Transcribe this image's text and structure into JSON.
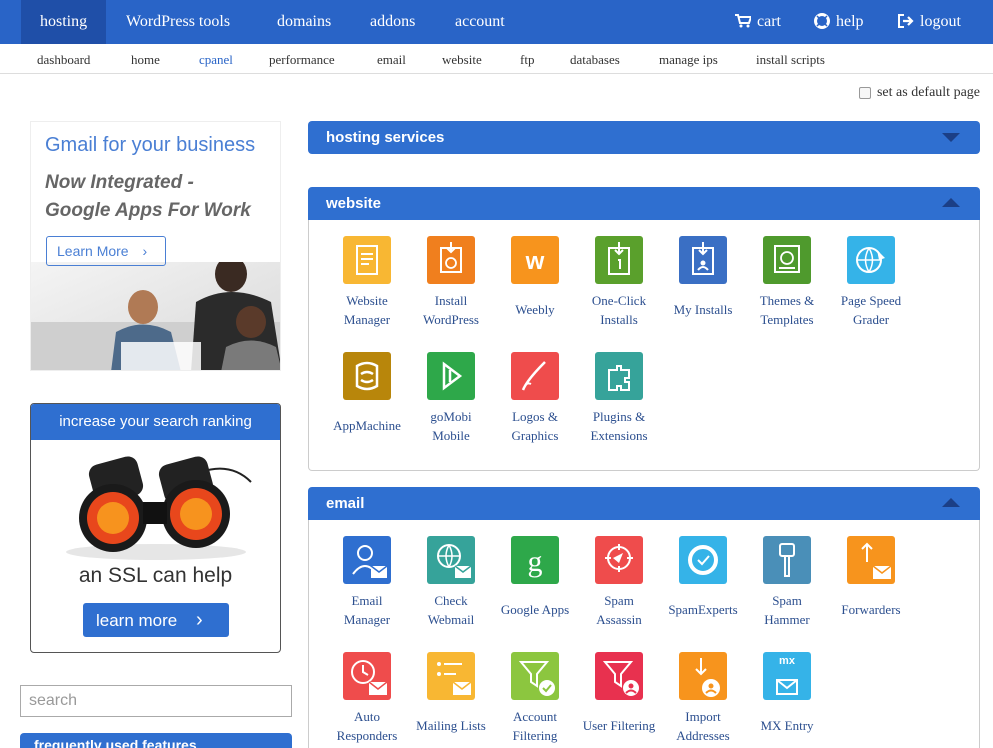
{
  "topnav": {
    "items": [
      {
        "label": "hosting",
        "active": true
      },
      {
        "label": "WordPress tools"
      },
      {
        "label": "domains"
      },
      {
        "label": "addons"
      },
      {
        "label": "account"
      }
    ],
    "right": [
      {
        "label": "cart",
        "icon": "cart-icon"
      },
      {
        "label": "help",
        "icon": "lifebuoy-icon"
      },
      {
        "label": "logout",
        "icon": "logout-icon"
      }
    ]
  },
  "subnav": [
    "dashboard",
    "home",
    "cpanel",
    "performance",
    "email",
    "website",
    "ftp",
    "databases",
    "manage ips",
    "install scripts"
  ],
  "default_page_label": "set as default page",
  "ads": {
    "gmail": {
      "title": "Gmail for your business",
      "line1": "Now Integrated -",
      "line2": "Google Apps For Work",
      "button": "Learn More"
    },
    "ssl": {
      "header": "increase your search ranking",
      "caption": "an SSL can help",
      "button": "learn more"
    }
  },
  "search": {
    "placeholder": "search"
  },
  "left_panel_title": "frequently used features",
  "panels": {
    "hosting": {
      "title": "hosting services"
    },
    "website": {
      "title": "website",
      "tools": [
        {
          "l1": "Website",
          "l2": "Manager",
          "color": "#f8b733"
        },
        {
          "l1": "Install",
          "l2": "WordPress",
          "color": "#f07f1e"
        },
        {
          "l1": "Weebly",
          "l2": "",
          "color": "#f7941d"
        },
        {
          "l1": "One-Click",
          "l2": "Installs",
          "color": "#5aa02c"
        },
        {
          "l1": "My Installs",
          "l2": "",
          "color": "#3a6fc4"
        },
        {
          "l1": "Themes &",
          "l2": "Templates",
          "color": "#4f9a2d"
        },
        {
          "l1": "Page Speed",
          "l2": "Grader",
          "color": "#35b3e8"
        },
        {
          "l1": "AppMachine",
          "l2": "",
          "color": "#b8860b"
        },
        {
          "l1": "goMobi",
          "l2": "Mobile",
          "color": "#2ea84a"
        },
        {
          "l1": "Logos &",
          "l2": "Graphics",
          "color": "#ef4c4c"
        },
        {
          "l1": "Plugins &",
          "l2": "Extensions",
          "color": "#36a39a"
        }
      ]
    },
    "email": {
      "title": "email",
      "tools": [
        {
          "l1": "Email",
          "l2": "Manager",
          "color": "#2f6fd0"
        },
        {
          "l1": "Check",
          "l2": "Webmail",
          "color": "#36a39a"
        },
        {
          "l1": "Google Apps",
          "l2": "",
          "color": "#2ea84a"
        },
        {
          "l1": "Spam",
          "l2": "Assassin",
          "color": "#ef4c4c"
        },
        {
          "l1": "SpamExperts",
          "l2": "",
          "color": "#35b3e8"
        },
        {
          "l1": "Spam",
          "l2": "Hammer",
          "color": "#4a8fb8"
        },
        {
          "l1": "Forwarders",
          "l2": "",
          "color": "#f7941d"
        },
        {
          "l1": "Auto",
          "l2": "Responders",
          "color": "#ef4c4c"
        },
        {
          "l1": "Mailing Lists",
          "l2": "",
          "color": "#f8b733"
        },
        {
          "l1": "Account",
          "l2": "Filtering",
          "color": "#8cc63f"
        },
        {
          "l1": "User Filtering",
          "l2": "",
          "color": "#e8314f"
        },
        {
          "l1": "Import",
          "l2": "Addresses",
          "color": "#f7941d"
        },
        {
          "l1": "MX Entry",
          "l2": "",
          "color": "#35b3e8",
          "badge": "mx"
        }
      ]
    }
  }
}
